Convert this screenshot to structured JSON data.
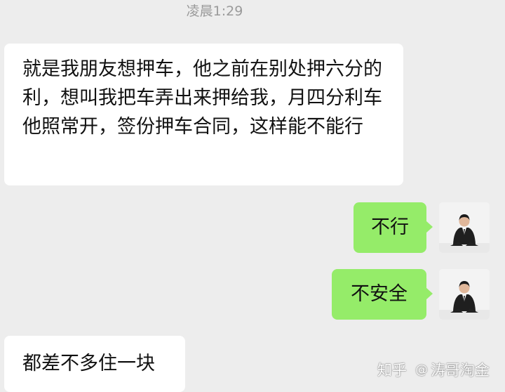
{
  "chat": {
    "timestamp": "凌晨1:29",
    "messages": [
      {
        "side": "left",
        "text": "就是我朋友想押车，他之前在别处押六分的利，想叫我把车弄出来押给我，月四分利车他照常开，签份押车合同，这样能不能行"
      },
      {
        "side": "right",
        "text": "不行"
      },
      {
        "side": "right",
        "text": "不安全"
      },
      {
        "side": "left",
        "text": "都差不多住一块"
      }
    ]
  },
  "watermark": {
    "platform": "知乎",
    "at": "@",
    "author": "涛哥淘金"
  },
  "colors": {
    "background": "#ededed",
    "incoming_bubble": "#ffffff",
    "outgoing_bubble": "#95ec69"
  },
  "icons": {
    "avatar": "user-photo-man-in-suit"
  }
}
